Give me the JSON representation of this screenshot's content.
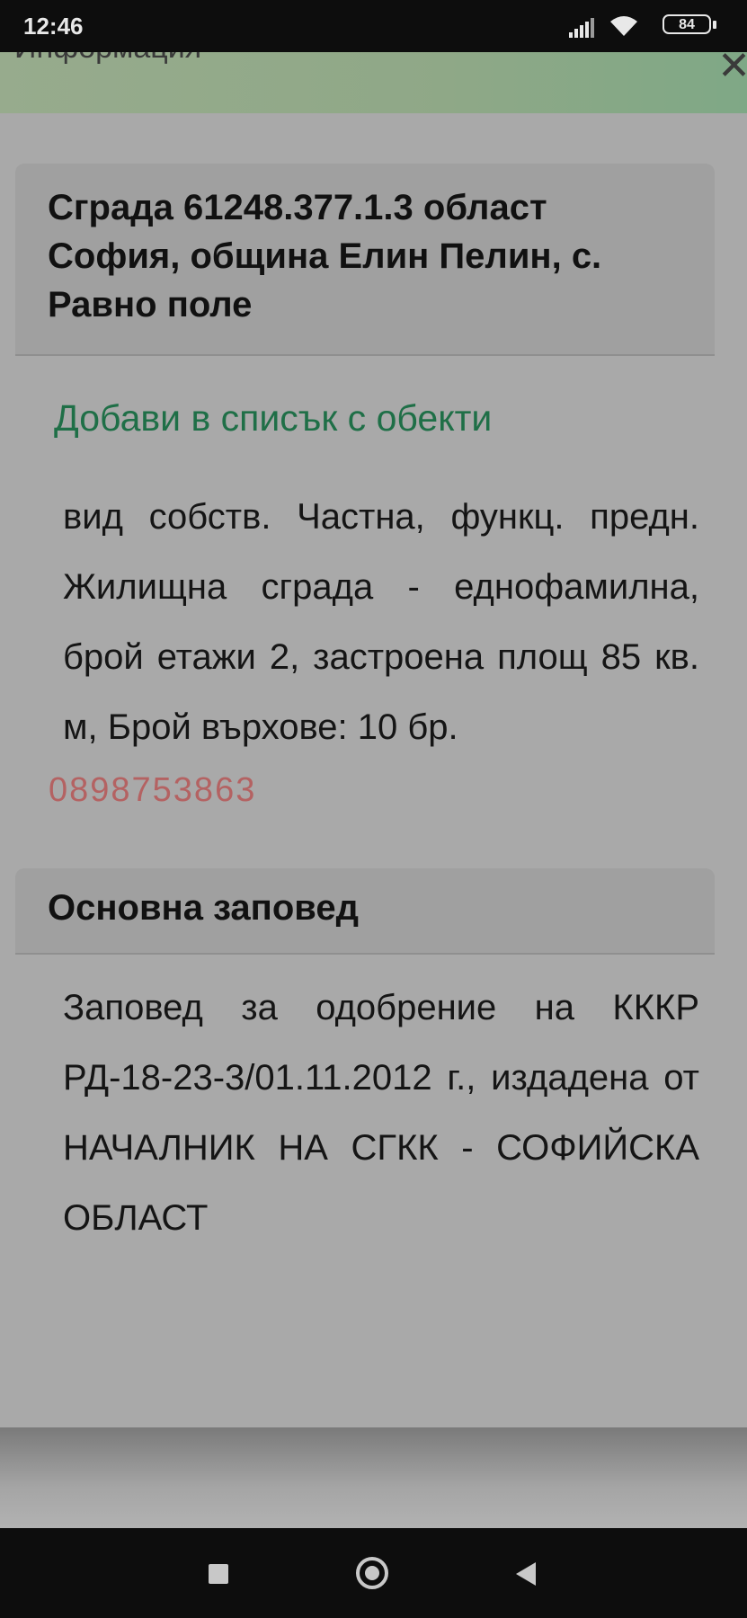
{
  "status_bar": {
    "time": "12:46",
    "battery": "84"
  },
  "header": {
    "title": "Информация"
  },
  "building": {
    "title": "Сграда 61248.377.1.3 област София, община Елин Пелин, с. Равно поле",
    "add_link": "Добави в списък с обекти",
    "description": "вид собств. Частна, функц. предн. Жилищна сграда - еднофамилна, брой етажи 2, застроена площ 85 кв. м, Брой върхове: 10 бр.",
    "watermark": "0898753863"
  },
  "order": {
    "heading": "Основна заповед",
    "text": "Заповед за одобрение на КККР РД-18-23-3/01.11.2012 г., издадена от НАЧАЛНИК НА СГКК - СОФИЙСКА ОБЛАСТ"
  },
  "colors": {
    "link": "#1f6f47",
    "header_bg": "#8fa887",
    "overlay": "#a9a9a9"
  },
  "icons": [
    "signal-icon",
    "wifi-icon",
    "battery-icon",
    "close-icon",
    "nav-recents-icon",
    "nav-home-icon",
    "nav-back-icon"
  ]
}
